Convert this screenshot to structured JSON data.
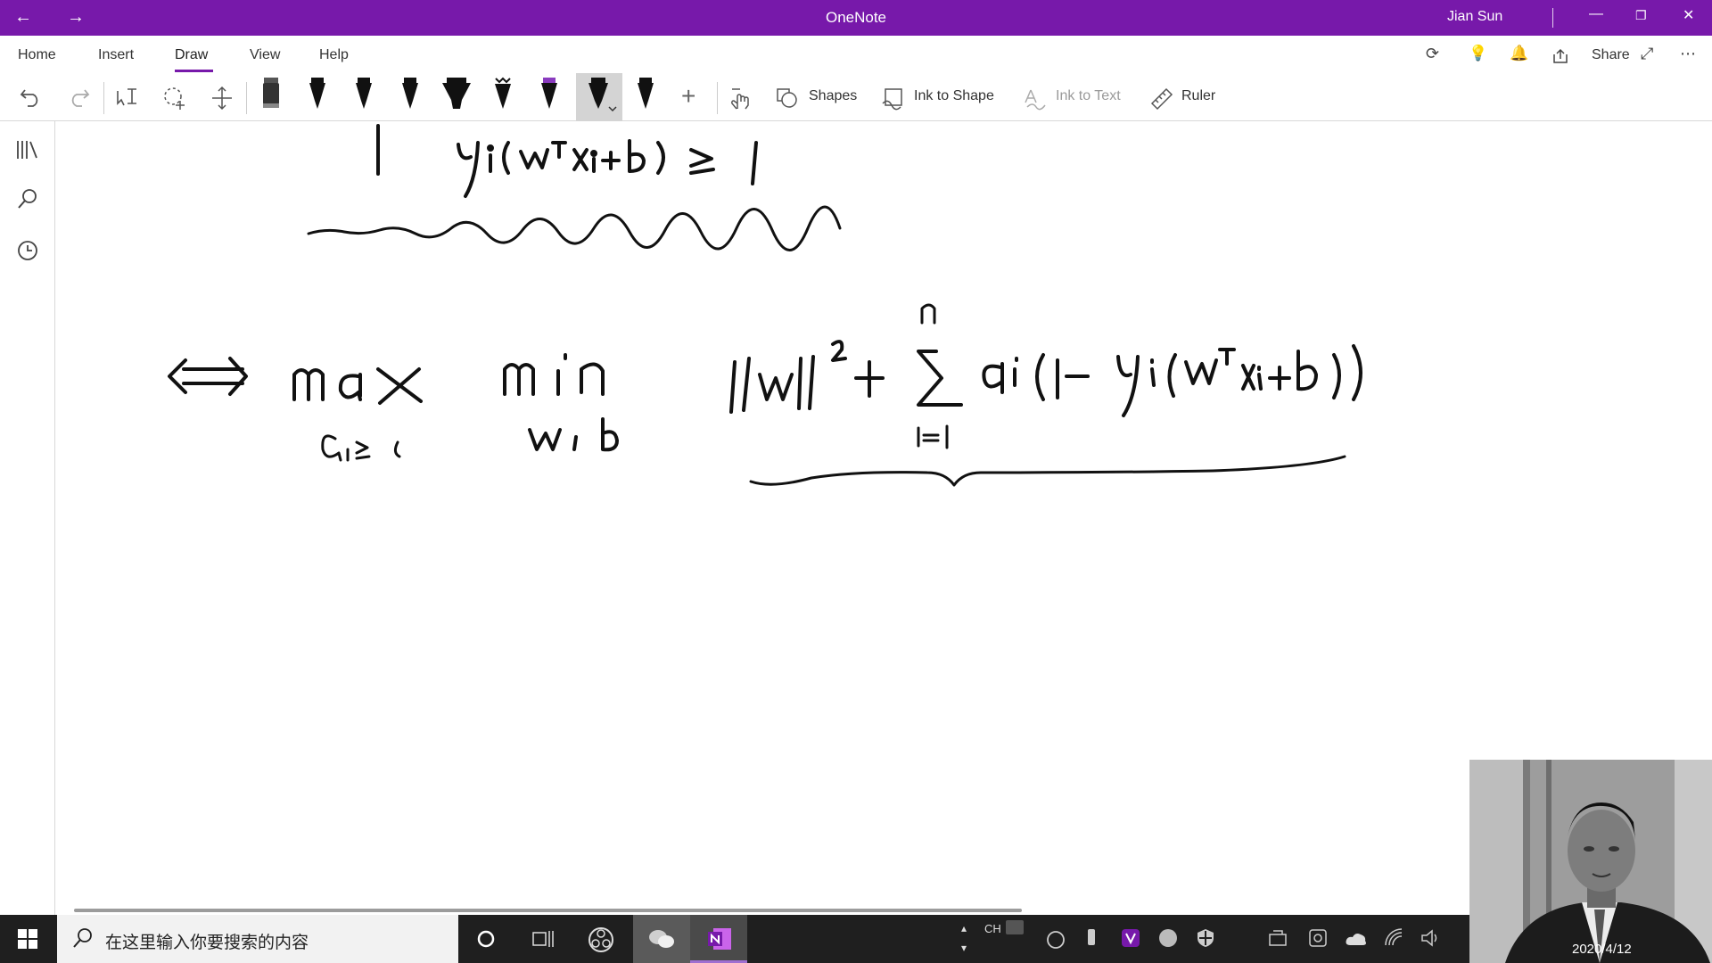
{
  "window": {
    "title": "OneNote",
    "user": "Jian Sun",
    "back_icon": "←",
    "forward_icon": "→",
    "minimize_icon": "—",
    "restore_icon": "❐",
    "close_icon": "✕"
  },
  "ribbon_tabs": [
    {
      "label": "Home"
    },
    {
      "label": "Insert"
    },
    {
      "label": "Draw",
      "active": true
    },
    {
      "label": "View"
    },
    {
      "label": "Help"
    }
  ],
  "ribbon_right": {
    "sync_icon": "⟳",
    "tips_icon": "💡",
    "notifications_icon": "🔔",
    "share_label": "Share",
    "fullscreen_icon": "⤢",
    "more_icon": "⋯"
  },
  "toolbar": {
    "shapes_label": "Shapes",
    "ink_to_shape_label": "Ink to Shape",
    "ink_to_text_label": "Ink to Text",
    "ruler_label": "Ruler",
    "add_pen_icon": "+",
    "accent_color": "#7719aa"
  },
  "taskbar": {
    "search_placeholder": "在这里输入你要搜索的内容",
    "input_indicator": "CH",
    "date": "2020/4/12",
    "background": "#1f1f1f"
  }
}
